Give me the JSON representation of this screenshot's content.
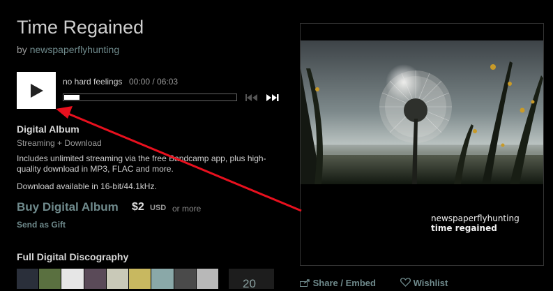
{
  "album": {
    "title": "Time Regained",
    "by_prefix": "by",
    "artist": "newspaperflyhunting"
  },
  "player": {
    "track_title": "no hard feelings",
    "time": "00:00 / 06:03",
    "progress": 0.0
  },
  "digital": {
    "heading": "Digital Album",
    "streaming": "Streaming + Download",
    "includes": "Includes unlimited streaming via the free Bandcamp app, plus high-quality download in MP3, FLAC and more.",
    "availability": "Download available in 16-bit/44.1kHz.",
    "buy_label": "Buy Digital Album",
    "price": "$2",
    "currency": "USD",
    "or_more": "or more",
    "gift_label": "Send as Gift"
  },
  "discography": {
    "heading": "Full Digital Discography",
    "count": "20"
  },
  "cover": {
    "artist": "newspaperflyhunting",
    "title": "time regained"
  },
  "actions": {
    "share": "Share / Embed",
    "wishlist": "Wishlist"
  },
  "icons": [
    "play-icon",
    "prev-track-icon",
    "next-track-icon",
    "share-icon",
    "heart-icon"
  ],
  "colors": {
    "link": "#6f8a8c",
    "annotation_arrow": "#e8101e"
  }
}
